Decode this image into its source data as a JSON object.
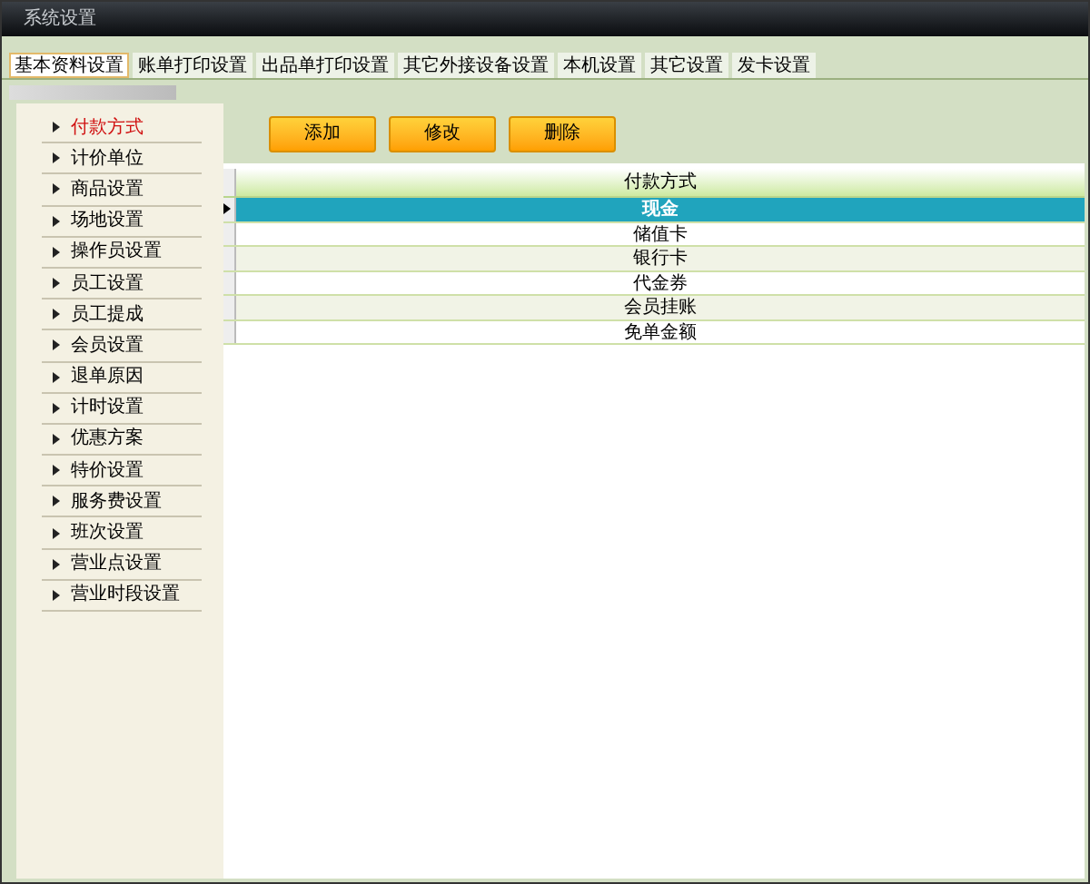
{
  "window": {
    "title": "系统设置"
  },
  "tabs": [
    {
      "label": "基本资料设置",
      "selected": true
    },
    {
      "label": "账单打印设置",
      "selected": false
    },
    {
      "label": "出品单打印设置",
      "selected": false
    },
    {
      "label": "其它外接设备设置",
      "selected": false
    },
    {
      "label": "本机设置",
      "selected": false
    },
    {
      "label": "其它设置",
      "selected": false
    },
    {
      "label": "发卡设置",
      "selected": false
    }
  ],
  "sidebar": {
    "items": [
      {
        "label": "付款方式",
        "selected": true
      },
      {
        "label": "计价单位",
        "selected": false
      },
      {
        "label": "商品设置",
        "selected": false
      },
      {
        "label": "场地设置",
        "selected": false
      },
      {
        "label": "操作员设置",
        "selected": false
      },
      {
        "label": "员工设置",
        "selected": false
      },
      {
        "label": "员工提成",
        "selected": false
      },
      {
        "label": "会员设置",
        "selected": false
      },
      {
        "label": "退单原因",
        "selected": false
      },
      {
        "label": "计时设置",
        "selected": false
      },
      {
        "label": "优惠方案",
        "selected": false
      },
      {
        "label": "特价设置",
        "selected": false
      },
      {
        "label": "服务费设置",
        "selected": false
      },
      {
        "label": "班次设置",
        "selected": false
      },
      {
        "label": "营业点设置",
        "selected": false
      },
      {
        "label": "营业时段设置",
        "selected": false
      }
    ]
  },
  "toolbar": {
    "buttons": [
      "添加",
      "修改",
      "删除"
    ]
  },
  "table": {
    "columns": [
      "付款方式"
    ],
    "rows": [
      {
        "cell": "现金",
        "selected": true
      },
      {
        "cell": "储值卡",
        "selected": false
      },
      {
        "cell": "银行卡",
        "selected": false
      },
      {
        "cell": "代金券",
        "selected": false
      },
      {
        "cell": "会员挂账",
        "selected": false
      },
      {
        "cell": "免单金额",
        "selected": false
      }
    ]
  }
}
